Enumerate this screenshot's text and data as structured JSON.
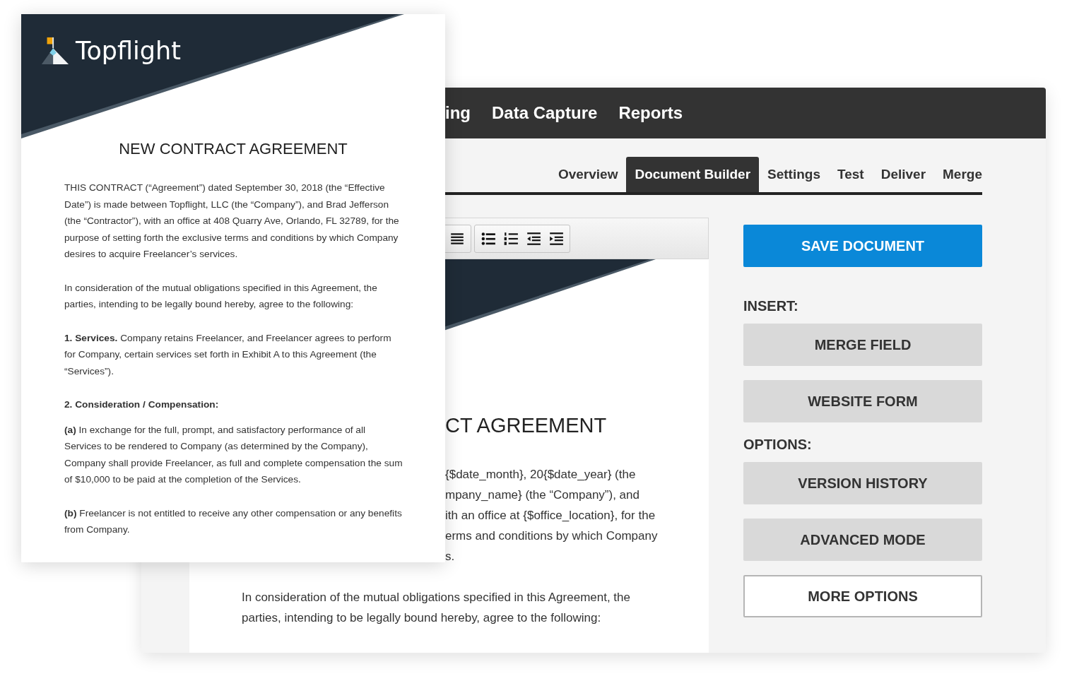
{
  "front_document": {
    "logo": "Topflight",
    "title": "NEW CONTRACT AGREEMENT",
    "paragraphs": [
      {
        "kind": "text",
        "text": "THIS CONTRACT (“Agreement”) dated September 30, 2018 (the “Effective Date”) is made between Topflight, LLC (the “Company”), and Brad Jefferson (the “Contractor”), with an office at 408 Quarry Ave, Orlando, FL 32789, for the purpose of setting forth the exclusive terms and conditions by which Company desires to acquire Freelancer’s services."
      },
      {
        "kind": "text",
        "text": "In consideration of the mutual obligations specified in this Agreement, the parties, intending to be legally bound hereby, agree to the following:"
      },
      {
        "kind": "text",
        "text": "**1. Services.** Company retains Freelancer, and Freelancer agrees to perform for Company, certain services set forth in Exhibit A to this Agreement (the “Services”)."
      },
      {
        "kind": "heading",
        "text": "2. Consideration / Compensation:"
      },
      {
        "kind": "text",
        "text": "**(a)** In exchange for the full, prompt, and satisfactory performance of all Services to be rendered to Company (as determined by the Company), Company shall provide Freelancer, as full and complete compensation the sum of $10,000 to be paid at the completion of the Services."
      },
      {
        "kind": "text",
        "text": "**(b)** Freelancer is not entitled to receive any other compensation or any benefits from Company."
      }
    ]
  },
  "app_window": {
    "nav": [
      "ing",
      "Data Capture",
      "Reports"
    ],
    "tabs": [
      {
        "label": "Overview",
        "selected": false
      },
      {
        "label": "Document Builder",
        "selected": true
      },
      {
        "label": "Settings",
        "selected": false
      },
      {
        "label": "Test",
        "selected": false
      },
      {
        "label": "Deliver",
        "selected": false
      },
      {
        "label": "Merge",
        "selected": false
      }
    ],
    "editor_page": {
      "title": "CT AGREEMENT",
      "partial_lines": [
        "{$date_month}, 20{$date_year} (the",
        "mpany_name} (the “Company”), and",
        "ith an office at {$office_location}, for the",
        "erms and conditions by which Company",
        "s."
      ],
      "paragraph": "In consideration of the mutual obligations specified in this Agreement, the parties, intending to be legally bound hereby, agree to the following:"
    },
    "side_panel": {
      "primary_button": "SAVE DOCUMENT",
      "sections": [
        {
          "heading": "INSERT:",
          "buttons": [
            {
              "label": "MERGE FIELD",
              "kind": "filled"
            },
            {
              "label": "WEBSITE FORM",
              "kind": "filled"
            }
          ]
        },
        {
          "heading": "OPTIONS:",
          "buttons": [
            {
              "label": "VERSION HISTORY",
              "kind": "filled"
            },
            {
              "label": "ADVANCED MODE",
              "kind": "filled"
            },
            {
              "label": "MORE OPTIONS",
              "kind": "outlined"
            }
          ]
        }
      ]
    }
  }
}
